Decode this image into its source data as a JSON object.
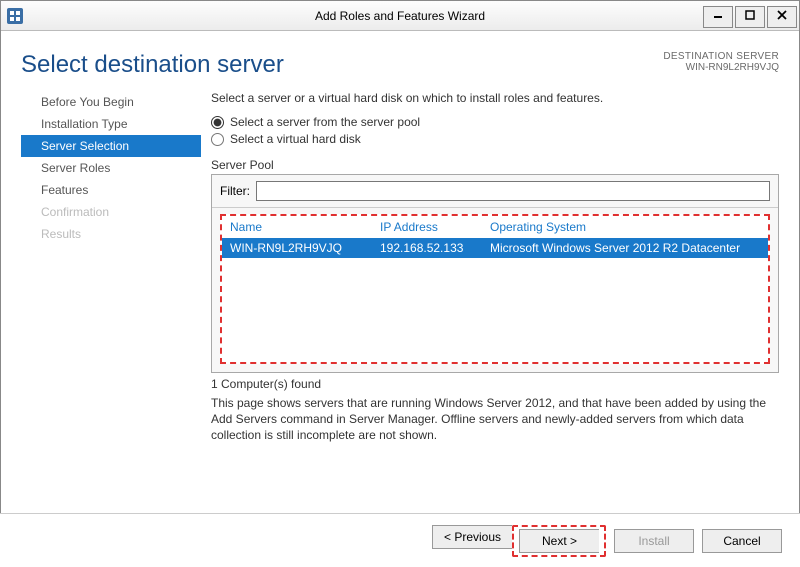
{
  "window": {
    "title": "Add Roles and Features Wizard"
  },
  "header": {
    "page_title": "Select destination server",
    "dest_label": "DESTINATION SERVER",
    "dest_value": "WIN-RN9L2RH9VJQ"
  },
  "sidebar": {
    "items": [
      {
        "label": "Before You Begin",
        "state": "normal"
      },
      {
        "label": "Installation Type",
        "state": "normal"
      },
      {
        "label": "Server Selection",
        "state": "active"
      },
      {
        "label": "Server Roles",
        "state": "normal"
      },
      {
        "label": "Features",
        "state": "normal"
      },
      {
        "label": "Confirmation",
        "state": "disabled"
      },
      {
        "label": "Results",
        "state": "disabled"
      }
    ]
  },
  "content": {
    "intro": "Select a server or a virtual hard disk on which to install roles and features.",
    "radio1": "Select a server from the server pool",
    "radio2": "Select a virtual hard disk",
    "pool_label": "Server Pool",
    "filter_label": "Filter:",
    "filter_value": "",
    "columns": {
      "name": "Name",
      "ip": "IP Address",
      "os": "Operating System"
    },
    "rows": [
      {
        "name": "WIN-RN9L2RH9VJQ",
        "ip": "192.168.52.133",
        "os": "Microsoft Windows Server 2012 R2 Datacenter"
      }
    ],
    "found": "1 Computer(s) found",
    "description": "This page shows servers that are running Windows Server 2012, and that have been added by using the Add Servers command in Server Manager. Offline servers and newly-added servers from which data collection is still incomplete are not shown."
  },
  "footer": {
    "previous": "< Previous",
    "next": "Next >",
    "install": "Install",
    "cancel": "Cancel"
  },
  "colors": {
    "accent": "#1979ca",
    "highlight_dash": "#e03030"
  }
}
